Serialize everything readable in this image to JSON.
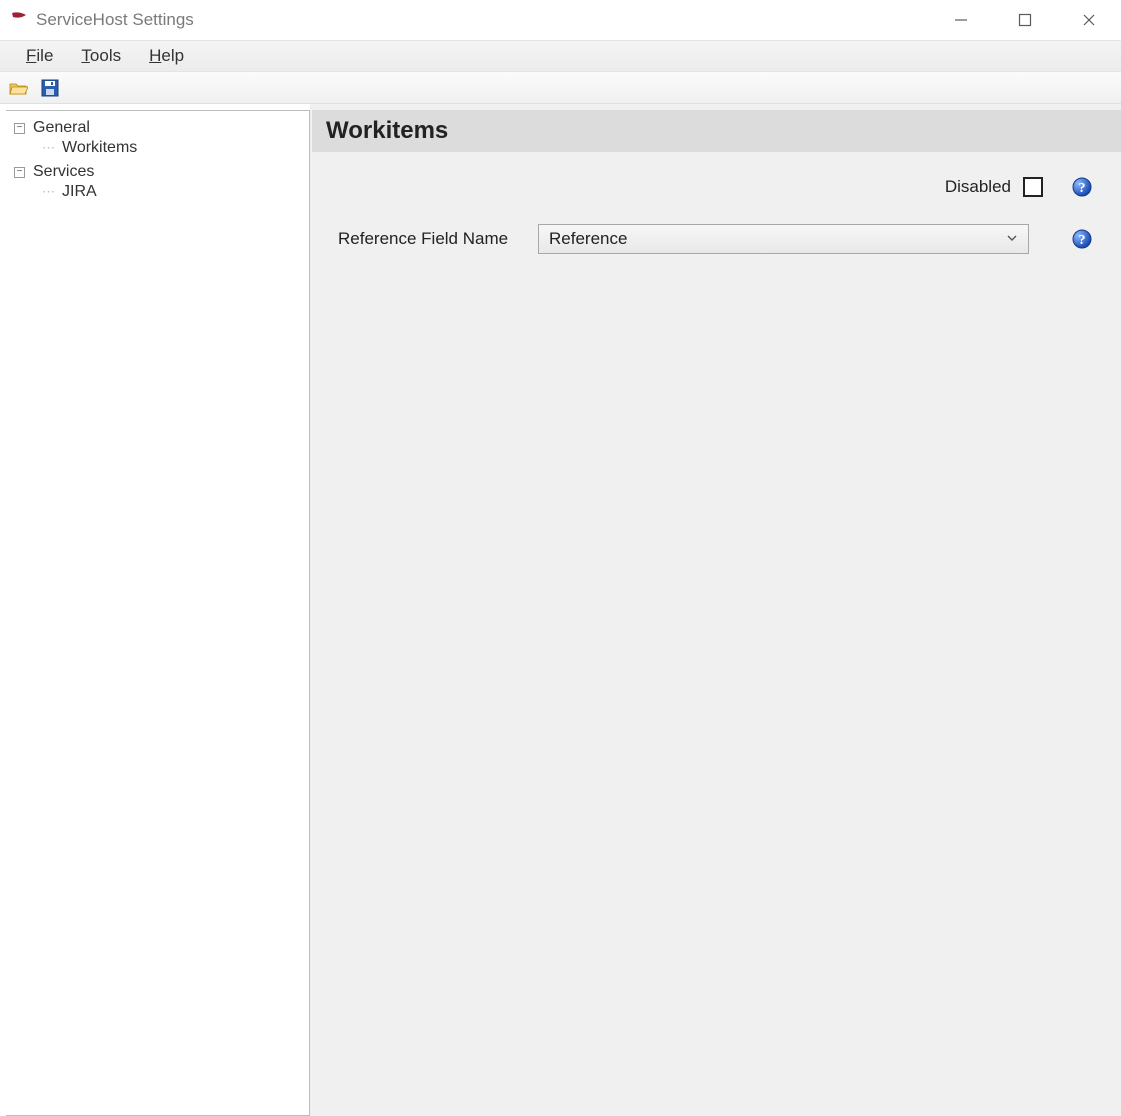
{
  "window": {
    "title": "ServiceHost Settings"
  },
  "menubar": {
    "file": "File",
    "tools": "Tools",
    "help": "Help"
  },
  "tree": {
    "general": {
      "label": "General",
      "children": {
        "workitems": "Workitems"
      }
    },
    "services": {
      "label": "Services",
      "children": {
        "jira": "JIRA"
      }
    }
  },
  "content": {
    "header": "Workitems",
    "disabled_label": "Disabled",
    "disabled_checked": false,
    "ref_field_label": "Reference Field Name",
    "ref_field_value": "Reference"
  }
}
